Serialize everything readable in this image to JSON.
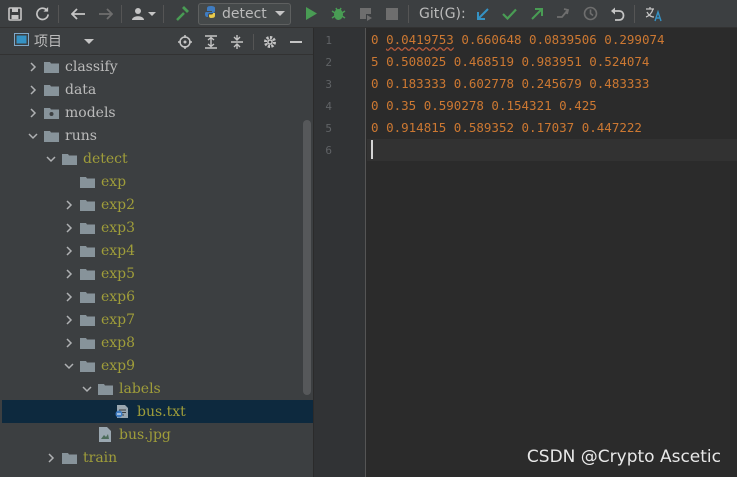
{
  "toolbar": {
    "run_config_label": "detect",
    "git_label": "Git(G):"
  },
  "project_panel": {
    "title": "项目",
    "tree": [
      {
        "label": "classify",
        "expanded": false,
        "style": "normal",
        "level": 1,
        "icon": "folder"
      },
      {
        "label": "data",
        "expanded": false,
        "style": "normal",
        "level": 1,
        "icon": "folder"
      },
      {
        "label": "models",
        "expanded": false,
        "style": "normal",
        "level": 1,
        "icon": "package-folder"
      },
      {
        "label": "runs",
        "expanded": true,
        "style": "normal",
        "level": 1,
        "icon": "folder"
      },
      {
        "label": "detect",
        "expanded": true,
        "style": "yellow",
        "level": 2,
        "icon": "folder"
      },
      {
        "label": "exp",
        "expanded": null,
        "style": "yellow",
        "level": 3,
        "icon": "folder"
      },
      {
        "label": "exp2",
        "expanded": false,
        "style": "yellow",
        "level": 3,
        "icon": "folder"
      },
      {
        "label": "exp3",
        "expanded": false,
        "style": "yellow",
        "level": 3,
        "icon": "folder"
      },
      {
        "label": "exp4",
        "expanded": false,
        "style": "yellow",
        "level": 3,
        "icon": "folder"
      },
      {
        "label": "exp5",
        "expanded": false,
        "style": "yellow",
        "level": 3,
        "icon": "folder"
      },
      {
        "label": "exp6",
        "expanded": false,
        "style": "yellow",
        "level": 3,
        "icon": "folder"
      },
      {
        "label": "exp7",
        "expanded": false,
        "style": "yellow",
        "level": 3,
        "icon": "folder"
      },
      {
        "label": "exp8",
        "expanded": false,
        "style": "yellow",
        "level": 3,
        "icon": "folder"
      },
      {
        "label": "exp9",
        "expanded": true,
        "style": "yellow",
        "level": 3,
        "icon": "folder"
      },
      {
        "label": "labels",
        "expanded": true,
        "style": "yellow",
        "level": 4,
        "icon": "folder"
      },
      {
        "label": "bus.txt",
        "expanded": null,
        "style": "yellow",
        "level": 5,
        "icon": "text-file",
        "selected": true
      },
      {
        "label": "bus.jpg",
        "expanded": null,
        "style": "yellow",
        "level": 4,
        "icon": "image-file"
      },
      {
        "label": "train",
        "expanded": false,
        "style": "yellow",
        "level": 2,
        "icon": "folder"
      }
    ]
  },
  "editor": {
    "line_numbers": [
      "1",
      "2",
      "3",
      "4",
      "5",
      "6"
    ],
    "lines": [
      {
        "prefix": "0 ",
        "rest_highlight": "0.0419753",
        "rest": " 0.660648 0.0839506 0.299074"
      },
      {
        "prefix": "5 ",
        "rest_highlight": "",
        "rest": "0.508025 0.468519 0.983951 0.524074"
      },
      {
        "prefix": "0 ",
        "rest_highlight": "",
        "rest": "0.183333 0.602778 0.245679 0.483333"
      },
      {
        "prefix": "0 ",
        "rest_highlight": "",
        "rest": "0.35 0.590278 0.154321 0.425"
      },
      {
        "prefix": "0 ",
        "rest_highlight": "",
        "rest": "0.914815 0.589352 0.17037 0.447222"
      },
      {
        "prefix": "",
        "rest_highlight": "",
        "rest": ""
      }
    ]
  },
  "watermark": "CSDN @Crypto Ascetic",
  "colors": {
    "code_text": "#cc7832",
    "folder_yellow": "#9f9d3a",
    "selection": "#0d293e",
    "run_green": "#499c54"
  }
}
